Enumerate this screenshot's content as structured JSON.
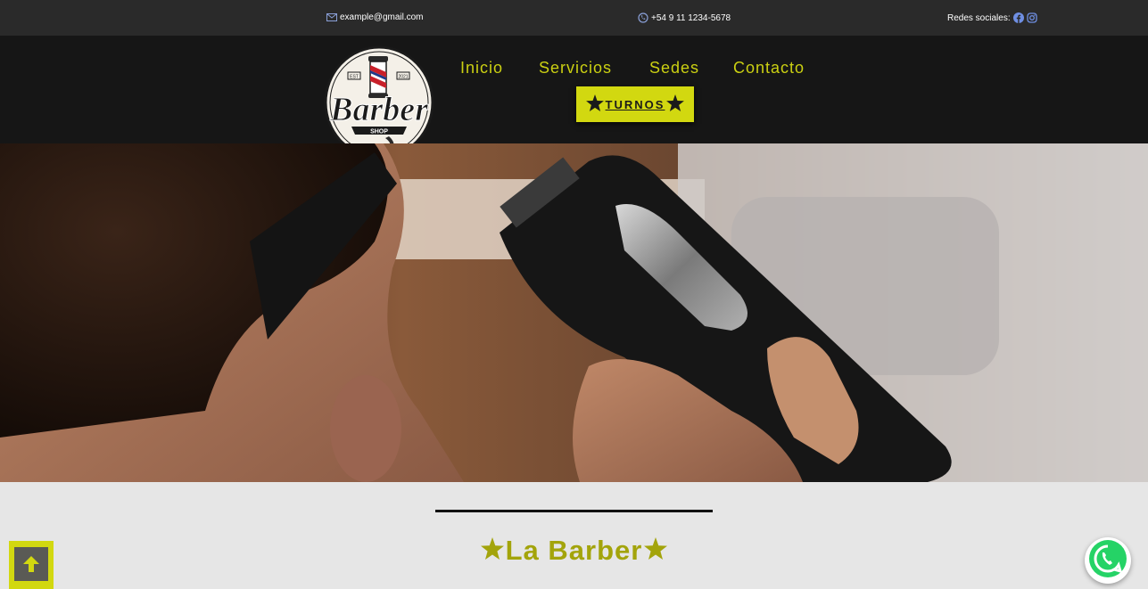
{
  "topbar": {
    "email": "example@gmail.com",
    "phone": "+54 9 11 1234-5678",
    "social_label": "Redes sociales:",
    "email_icon": "envelope-icon",
    "phone_icon": "whatsapp-icon",
    "social_icons": [
      "facebook-icon",
      "instagram-icon"
    ]
  },
  "header": {
    "logo": {
      "script": "Barber",
      "band": "SHOP",
      "left_year": "EST",
      "right_year": "2021"
    },
    "nav": [
      "Inicio",
      "Servicios",
      "Sedes",
      "Contacto"
    ],
    "cta": {
      "label": "TURNOS",
      "icon": "star-icon"
    }
  },
  "hero": {
    "image": "barber-clipper-photo"
  },
  "section": {
    "title": "La Barber",
    "icon": "star-icon"
  },
  "floating": {
    "scroll_top_icon": "arrow-up-icon",
    "chat_icon": "whatsapp-icon"
  },
  "colors": {
    "accent": "#d2d810",
    "nav_text": "#cbd012",
    "title_text": "#a3a40b",
    "topbar_bg": "#2a2a2a",
    "header_bg": "#161616",
    "page_bg": "#e6e6e6",
    "whatsapp_green": "#25d366"
  }
}
